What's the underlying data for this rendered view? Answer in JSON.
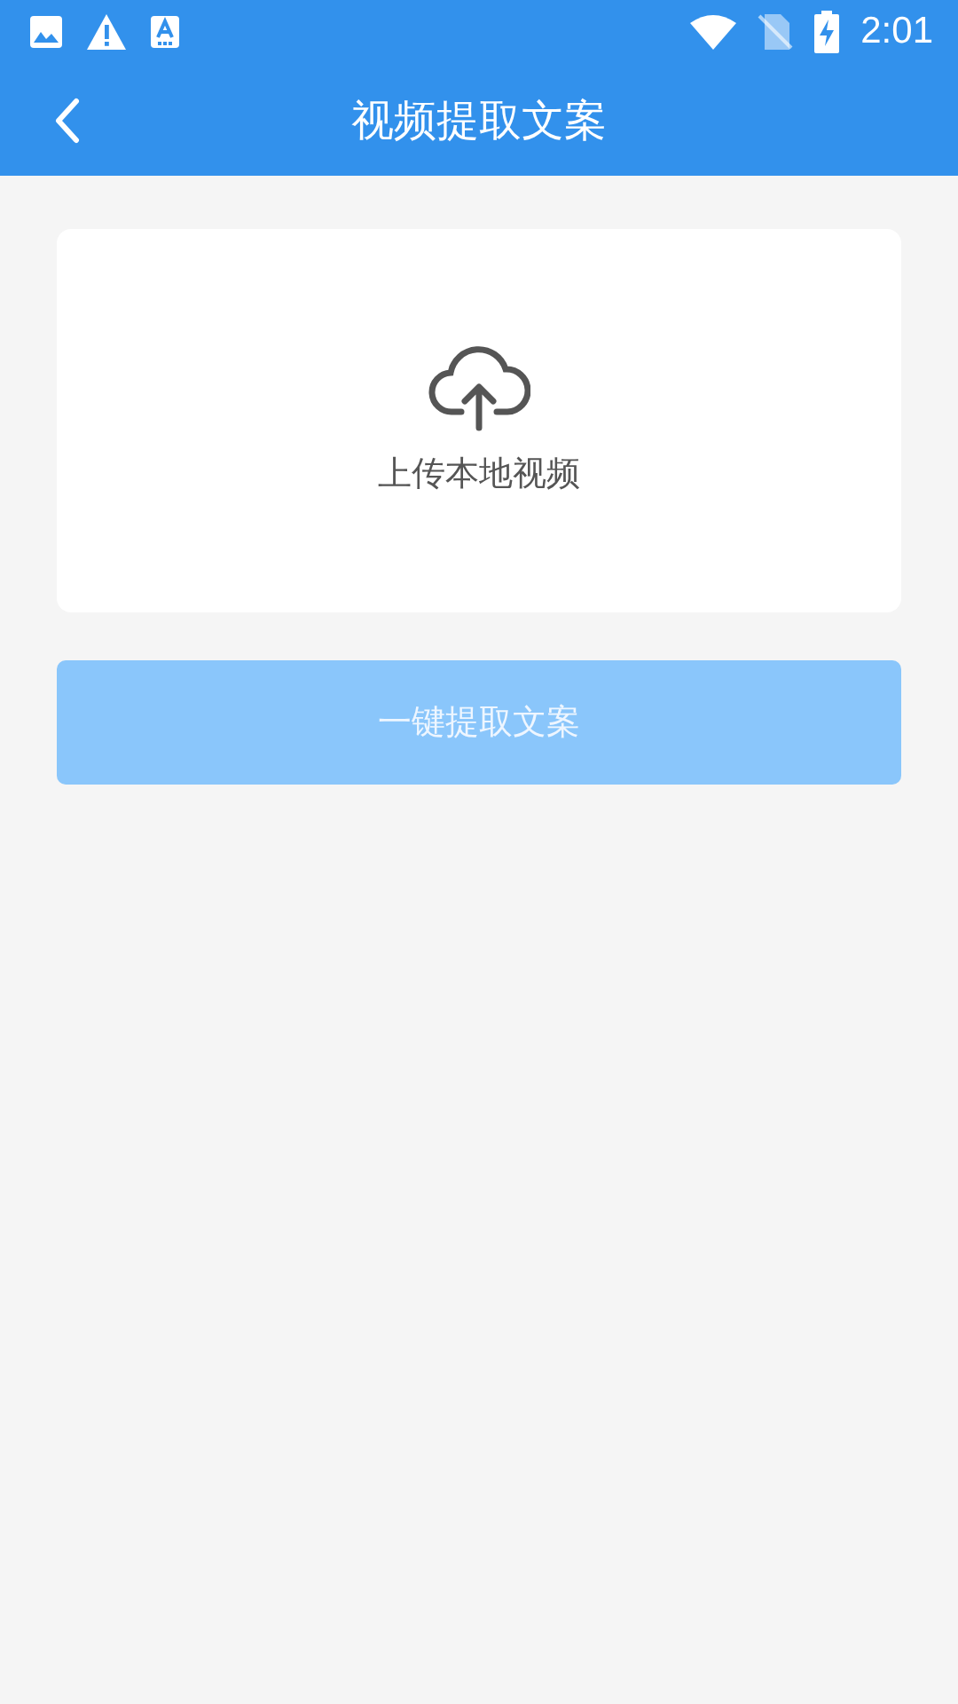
{
  "status_bar": {
    "time": "2:01"
  },
  "header": {
    "title": "视频提取文案"
  },
  "upload_card": {
    "label": "上传本地视频"
  },
  "extract_button": {
    "label": "一键提取文案",
    "disabled": true
  }
}
